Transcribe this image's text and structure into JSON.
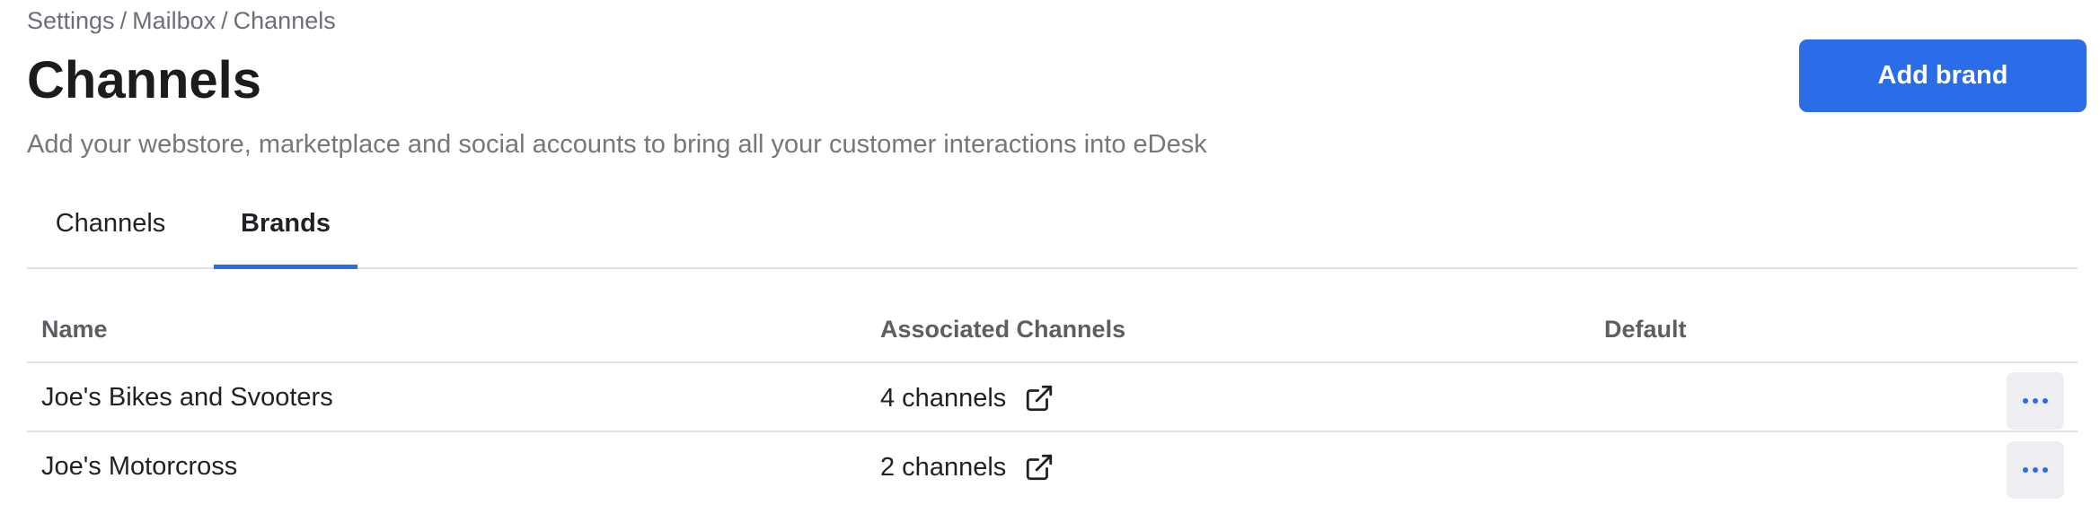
{
  "breadcrumb": [
    "Settings",
    "Mailbox",
    "Channels"
  ],
  "breadcrumb_separator": "/",
  "header": {
    "title": "Channels",
    "subtitle": "Add your webstore, marketplace and social accounts to bring all your customer interactions into eDesk",
    "add_button": "Add brand"
  },
  "tabs": [
    {
      "label": "Channels",
      "active": false
    },
    {
      "label": "Brands",
      "active": true
    }
  ],
  "table": {
    "columns": [
      "Name",
      "Associated Channels",
      "Default"
    ],
    "rows": [
      {
        "name": "Joe's Bikes and Svooters",
        "channels": "4 channels",
        "default": ""
      },
      {
        "name": "Joe's Motorcross",
        "channels": "2 channels",
        "default": ""
      }
    ]
  },
  "icons": {
    "open_external": "external-link-icon",
    "more": "more-horizontal-icon"
  },
  "colors": {
    "accent": "#2b6de8",
    "muted_text": "#74777c",
    "border": "#dfe2e7"
  }
}
